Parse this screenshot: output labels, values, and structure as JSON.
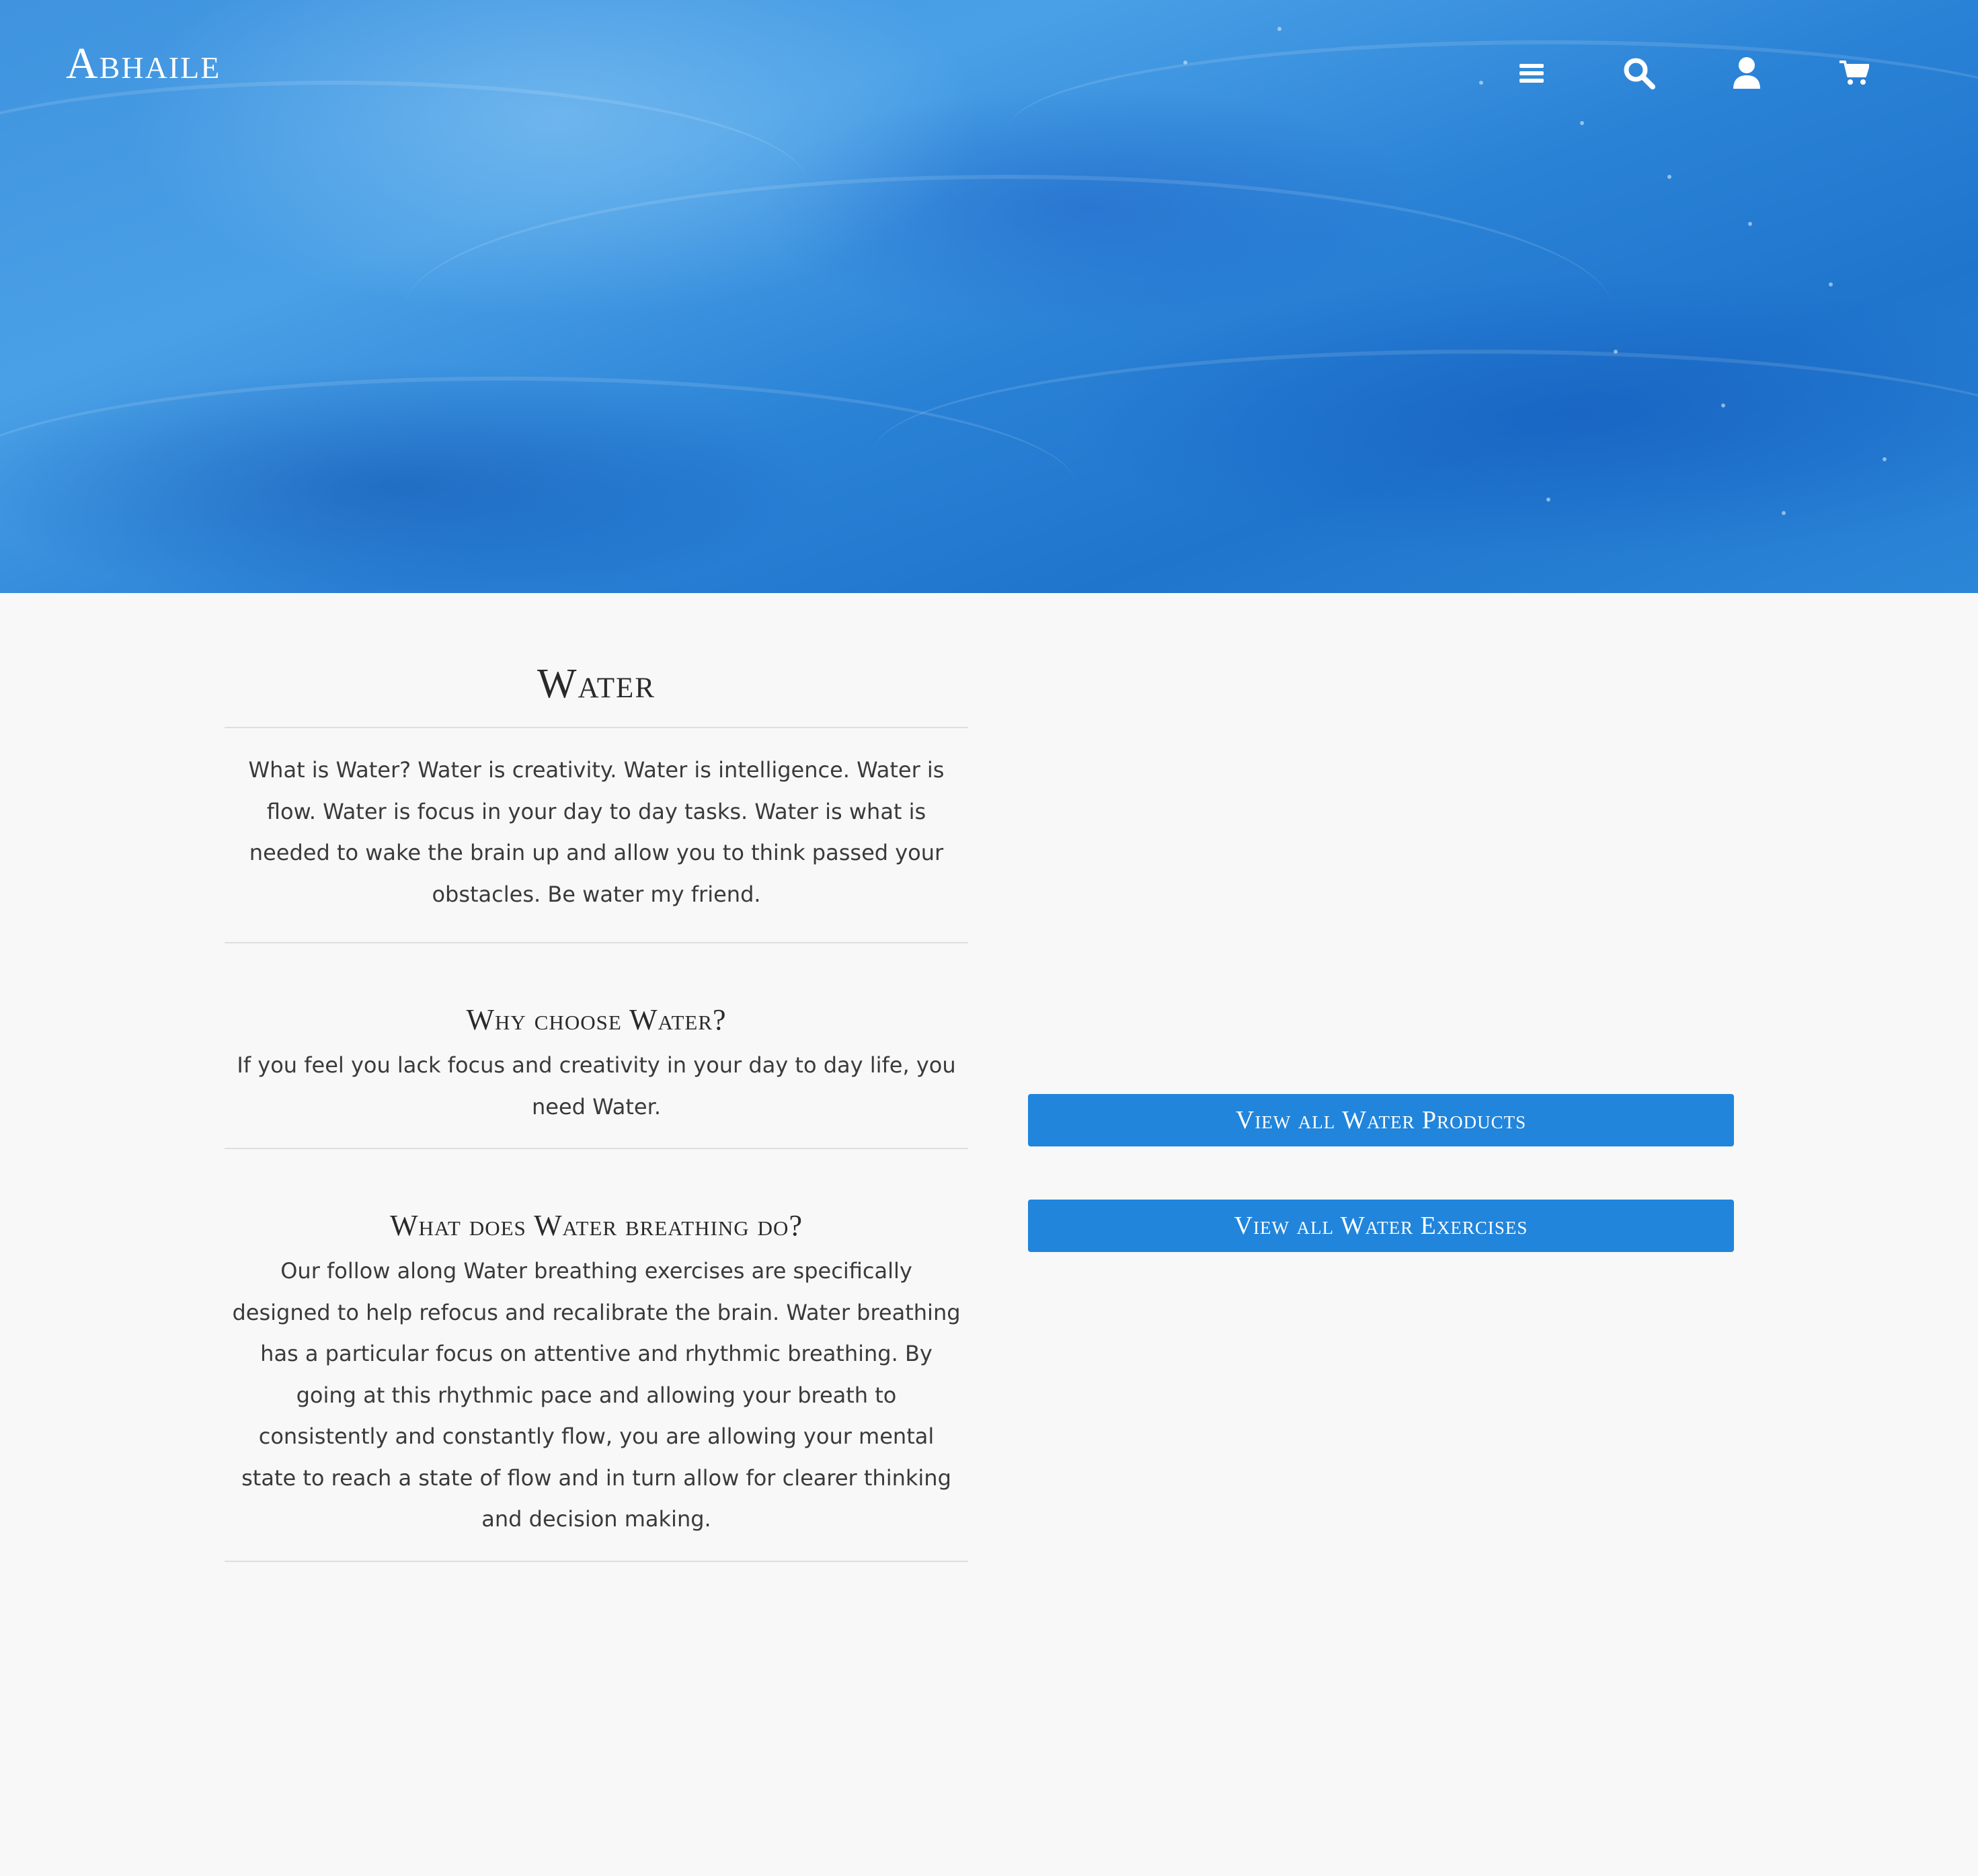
{
  "header": {
    "logo": "Abhaile",
    "icons": [
      "menu-icon",
      "search-icon",
      "account-icon",
      "cart-icon"
    ]
  },
  "colors": {
    "accent": "#2185dc",
    "hero_water": "#2a82d6",
    "background": "#f8f8f8",
    "text": "#333333"
  },
  "main": {
    "title": "Water",
    "intro": "What is Water? Water is creativity. Water is intelligence. Water is flow. Water is focus in your day to day tasks. Water is what is needed to wake the brain up and allow you to think passed your obstacles. Be water my friend.",
    "sections": [
      {
        "heading": "Why choose Water?",
        "body": "If you feel you lack focus and creativity in your day to day life, you need Water."
      },
      {
        "heading": "What does Water breathing do?",
        "body": "Our follow along Water breathing exercises are specifically designed to help refocus and recalibrate the brain. Water breathing has a particular focus on attentive and rhythmic breathing. By going at this rhythmic pace and allowing your breath to consistently and constantly flow, you are allowing your mental state to reach a state of flow and in turn allow for clearer thinking and decision making."
      }
    ],
    "buttons": {
      "products": "View all Water Products",
      "exercises": "View all Water Exercises"
    }
  }
}
